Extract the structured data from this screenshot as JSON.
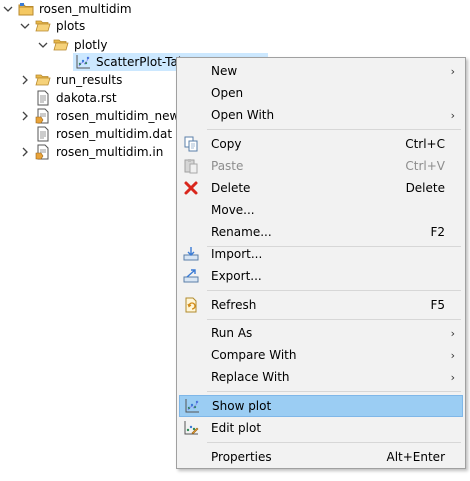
{
  "tree": {
    "items": [
      {
        "label": "rosen_multidim",
        "icon": "project-icon",
        "twisty": "expanded"
      },
      {
        "label": "plots",
        "icon": "folder-icon",
        "twisty": "expanded"
      },
      {
        "label": "plotly",
        "icon": "folder-icon",
        "twisty": "expanded"
      },
      {
        "label": "ScatterPlot-Tab",
        "icon": "scatter-plot-file-icon",
        "twisty": "none"
      },
      {
        "label": "run_results",
        "icon": "folder-icon",
        "twisty": "collapsed"
      },
      {
        "label": "dakota.rst",
        "icon": "text-file-icon",
        "twisty": "none"
      },
      {
        "label": "rosen_multidim_new.in",
        "icon": "dakota-input-file-icon",
        "twisty": "collapsed"
      },
      {
        "label": "rosen_multidim.dat",
        "icon": "text-file-icon",
        "twisty": "none"
      },
      {
        "label": "rosen_multidim.in",
        "icon": "dakota-input-file-icon",
        "twisty": "collapsed"
      }
    ]
  },
  "menu": {
    "items": [
      {
        "label": "New",
        "accel": "",
        "submenu": true,
        "icon": ""
      },
      {
        "label": "Open",
        "accel": "",
        "submenu": false,
        "icon": ""
      },
      {
        "label": "Open With",
        "accel": "",
        "submenu": true,
        "icon": ""
      },
      {
        "label": "Copy",
        "accel": "Ctrl+C",
        "submenu": false,
        "icon": "copy-icon"
      },
      {
        "label": "Paste",
        "accel": "Ctrl+V",
        "submenu": false,
        "icon": "paste-icon",
        "disabled": true
      },
      {
        "label": "Delete",
        "accel": "Delete",
        "submenu": false,
        "icon": "delete-icon"
      },
      {
        "label": "Move...",
        "accel": "",
        "submenu": false,
        "icon": ""
      },
      {
        "label": "Rename...",
        "accel": "F2",
        "submenu": false,
        "icon": ""
      },
      {
        "label": "Import...",
        "accel": "",
        "submenu": false,
        "icon": "import-icon"
      },
      {
        "label": "Export...",
        "accel": "",
        "submenu": false,
        "icon": "export-icon"
      },
      {
        "label": "Refresh",
        "accel": "F5",
        "submenu": false,
        "icon": "refresh-icon"
      },
      {
        "label": "Run As",
        "accel": "",
        "submenu": true,
        "icon": ""
      },
      {
        "label": "Compare With",
        "accel": "",
        "submenu": true,
        "icon": ""
      },
      {
        "label": "Replace With",
        "accel": "",
        "submenu": true,
        "icon": ""
      },
      {
        "label": "Show plot",
        "accel": "",
        "submenu": false,
        "icon": "show-plot-icon",
        "highlighted": true
      },
      {
        "label": "Edit plot",
        "accel": "",
        "submenu": false,
        "icon": "edit-plot-icon"
      },
      {
        "label": "Properties",
        "accel": "Alt+Enter",
        "submenu": false,
        "icon": ""
      }
    ]
  },
  "colors": {
    "selection": "#cce8ff",
    "menu_bg": "#f2f2f2",
    "menu_highlight": "#9bcdf3",
    "folder": "#e8b84a",
    "delete_red": "#d9261c"
  }
}
